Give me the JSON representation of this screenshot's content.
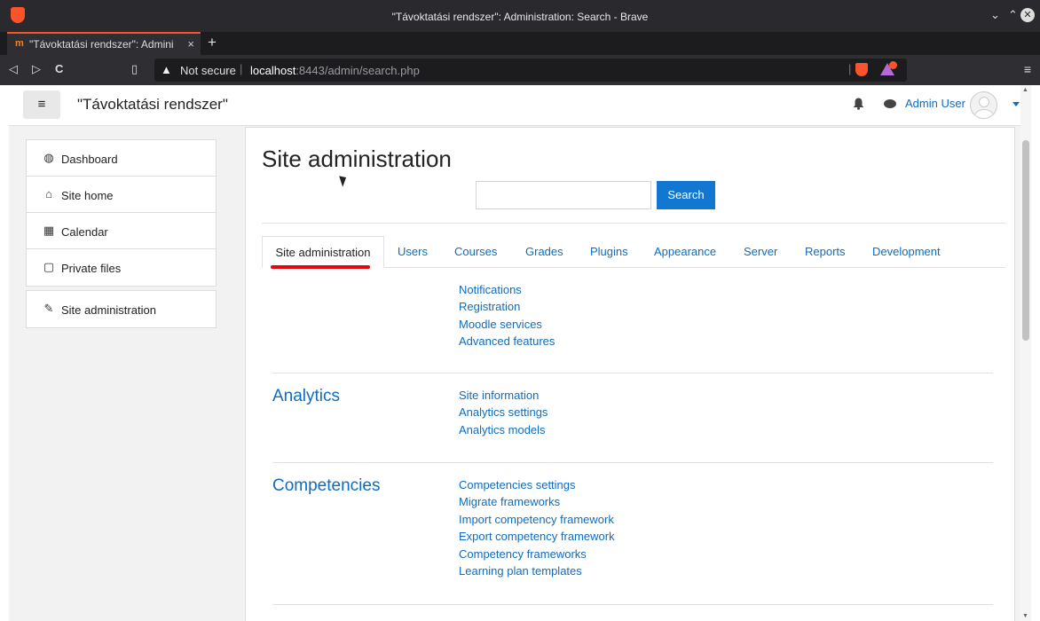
{
  "window": {
    "title": "\"Távoktatási rendszer\": Administration: Search - Brave",
    "controls": {
      "minimize": "⌄",
      "maximize": "⌃",
      "close": "✕"
    }
  },
  "browser": {
    "tab": {
      "icon": "m",
      "label": "\"Távoktatási rendszer\": Admini",
      "close": "×"
    },
    "newtab": "+",
    "nav": {
      "back": "◁",
      "forward": "▷",
      "reload": "C",
      "bookmark": "▯"
    },
    "address": {
      "warning": "▲",
      "security_label": "Not secure",
      "separator": "|",
      "host": "localhost",
      "rest": ":8443/admin/search.php"
    },
    "menu": "≡"
  },
  "navbar": {
    "drawer_toggle": "≡",
    "site_name": "\"Távoktatási rendszer\"",
    "user_name": "Admin User"
  },
  "drawer": {
    "items": [
      {
        "label": "Dashboard",
        "icon": "dashboard-icon",
        "glyph": "◍"
      },
      {
        "label": "Site home",
        "icon": "home-icon",
        "glyph": "⌂"
      },
      {
        "label": "Calendar",
        "icon": "calendar-icon",
        "glyph": "▦"
      },
      {
        "label": "Private files",
        "icon": "file-icon",
        "glyph": "▢"
      }
    ],
    "admin": {
      "label": "Site administration",
      "icon": "wrench-icon",
      "glyph": "✎"
    }
  },
  "main": {
    "title": "Site administration",
    "search": {
      "value": "",
      "placeholder": "",
      "button": "Search"
    },
    "tabs": [
      {
        "label": "Site administration",
        "active": true
      },
      {
        "label": "Users"
      },
      {
        "label": "Courses"
      },
      {
        "label": "Grades"
      },
      {
        "label": "Plugins"
      },
      {
        "label": "Appearance"
      },
      {
        "label": "Server"
      },
      {
        "label": "Reports"
      },
      {
        "label": "Development"
      }
    ],
    "sections": [
      {
        "title": "",
        "links": [
          "Notifications",
          "Registration",
          "Moodle services",
          "Advanced features"
        ]
      },
      {
        "title": "Analytics",
        "links": [
          "Site information",
          "Analytics settings",
          "Analytics models"
        ]
      },
      {
        "title": "Competencies",
        "links": [
          "Competencies settings",
          "Migrate frameworks",
          "Import competency framework",
          "Export competency framework",
          "Competency frameworks",
          "Learning plan templates"
        ]
      }
    ]
  },
  "colors": {
    "link": "#0f6cbf",
    "button": "#1177d1",
    "highlight": "#e8050a"
  }
}
